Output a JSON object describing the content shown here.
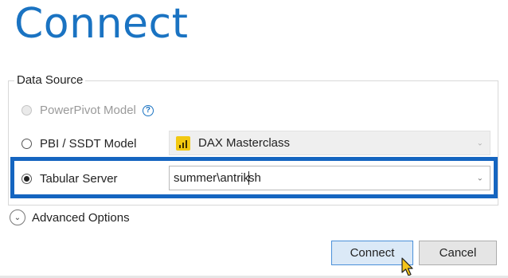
{
  "dialog": {
    "title": "Connect",
    "group_label": "Data Source",
    "options": [
      {
        "label": "PowerPivot Model",
        "state": "disabled",
        "has_help_icon": true
      },
      {
        "label": "PBI / SSDT Model",
        "state": "unchecked"
      },
      {
        "label": "Tabular Server",
        "state": "checked"
      }
    ],
    "pbi_model_combo": {
      "value": "DAX Masterclass",
      "icon": "power-bi-icon",
      "enabled": false
    },
    "server_combo": {
      "value_before_caret": "summer\\antrik",
      "value_after_caret": "sh",
      "enabled": true
    },
    "advanced_options_label": "Advanced Options",
    "buttons": {
      "connect": "Connect",
      "cancel": "Cancel"
    }
  },
  "colors": {
    "title": "#1a73c2",
    "highlight": "#1565c0",
    "connect_button_bg": "#dbe9f7",
    "connect_button_border": "#4a90d9",
    "power_bi_icon": "#f2c811"
  }
}
